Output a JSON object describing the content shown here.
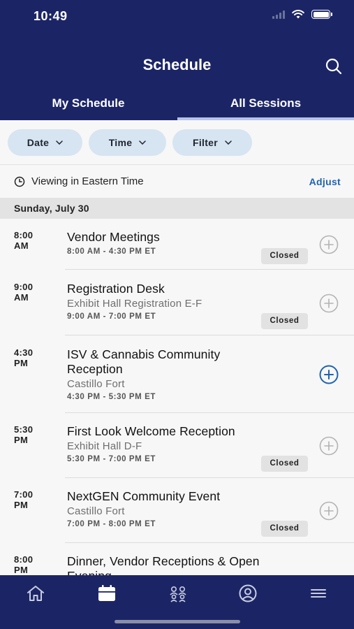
{
  "status_bar": {
    "time": "10:49"
  },
  "header": {
    "title": "Schedule"
  },
  "tabs": [
    {
      "label": "My Schedule",
      "active": false
    },
    {
      "label": "All Sessions",
      "active": true
    }
  ],
  "filters": [
    {
      "label": "Date"
    },
    {
      "label": "Time"
    },
    {
      "label": "Filter"
    }
  ],
  "timezone": {
    "text": "Viewing in Eastern Time",
    "action": "Adjust"
  },
  "day_header": "Sunday, July 30",
  "sessions": [
    {
      "time": "8:00",
      "ampm": "AM",
      "title": "Vendor Meetings",
      "location": "",
      "range": "8:00 AM - 4:30 PM ET",
      "badge": "Closed",
      "add_enabled": false
    },
    {
      "time": "9:00",
      "ampm": "AM",
      "title": "Registration Desk",
      "location": "Exhibit Hall Registration E-F",
      "range": "9:00 AM - 7:00 PM ET",
      "badge": "Closed",
      "add_enabled": false
    },
    {
      "time": "4:30",
      "ampm": "PM",
      "title": "ISV & Cannabis Community Reception",
      "location": "Castillo Fort",
      "range": "4:30 PM - 5:30 PM ET",
      "badge": "",
      "add_enabled": true
    },
    {
      "time": "5:30",
      "ampm": "PM",
      "title": "First Look Welcome Reception",
      "location": "Exhibit Hall D-F",
      "range": "5:30 PM - 7:00 PM ET",
      "badge": "Closed",
      "add_enabled": false
    },
    {
      "time": "7:00",
      "ampm": "PM",
      "title": "NextGEN Community Event",
      "location": "Castillo Fort",
      "range": "7:00 PM - 8:00 PM ET",
      "badge": "Closed",
      "add_enabled": false
    },
    {
      "time": "8:00",
      "ampm": "PM",
      "title": "Dinner, Vendor Receptions & Open Evening",
      "location": "",
      "range": "",
      "badge": "",
      "add_enabled": false
    }
  ],
  "tabbar": [
    {
      "icon": "home-icon"
    },
    {
      "icon": "calendar-icon",
      "active": true
    },
    {
      "icon": "people-icon"
    },
    {
      "icon": "profile-icon"
    },
    {
      "icon": "menu-icon"
    }
  ],
  "colors": {
    "header_bg": "#1b2566",
    "chip_bg": "#d7e4f2",
    "accent": "#1f63b0",
    "tab_indicator": "#b7c3e6"
  }
}
